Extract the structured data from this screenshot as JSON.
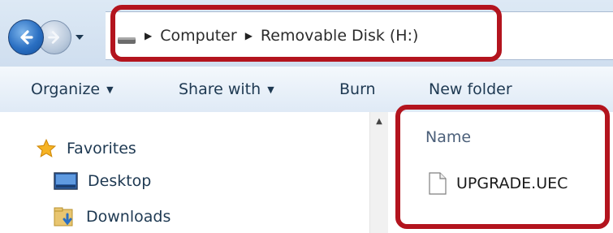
{
  "address_bar": {
    "drive_icon": "drive-icon",
    "breadcrumb": [
      "Computer",
      "Removable Disk (H:)"
    ]
  },
  "toolbar": {
    "organize_label": "Organize",
    "share_label": "Share with",
    "burn_label": "Burn",
    "new_folder_label": "New folder"
  },
  "navigation": {
    "items": [
      {
        "label": "Favorites",
        "icon": "star-icon"
      },
      {
        "label": "Desktop",
        "icon": "desktop-icon"
      },
      {
        "label": "Downloads",
        "icon": "downloads-icon"
      }
    ]
  },
  "content": {
    "column_header": "Name",
    "files": [
      {
        "name": "UPGRADE.UEC",
        "icon": "file-icon"
      }
    ]
  },
  "annotations": {
    "color": "#b3141e"
  }
}
